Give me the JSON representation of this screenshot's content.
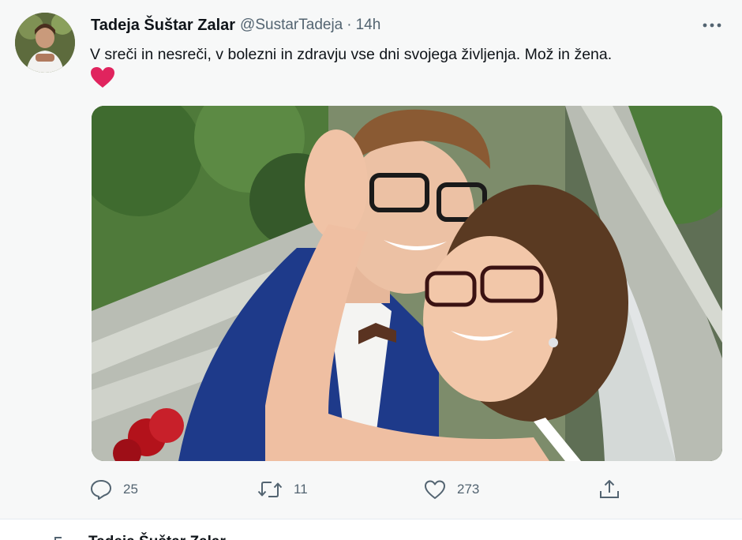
{
  "tweet": {
    "author_name": "Tadeja Šuštar Zalar",
    "handle": "@SustarTadeja",
    "separator": "·",
    "time": "14h",
    "text": "V sreči in nesreči, v bolezni in zdravju vse dni svojega življenja. Mož in žena.",
    "emoji": "heart-emoji",
    "more_icon": "more-horizontal-icon"
  },
  "actions": {
    "reply": {
      "icon": "reply-icon",
      "count": "25"
    },
    "retweet": {
      "icon": "retweet-icon",
      "count": "11"
    },
    "like": {
      "icon": "like-icon",
      "count": "273"
    },
    "share": {
      "icon": "share-icon"
    }
  },
  "next_tweet": {
    "author_peek": "Tadeja Šuštar Zalar"
  },
  "colors": {
    "text_primary": "#0f1419",
    "text_secondary": "#536471",
    "heart": "#e0245e",
    "background": "#f7f8f8"
  }
}
